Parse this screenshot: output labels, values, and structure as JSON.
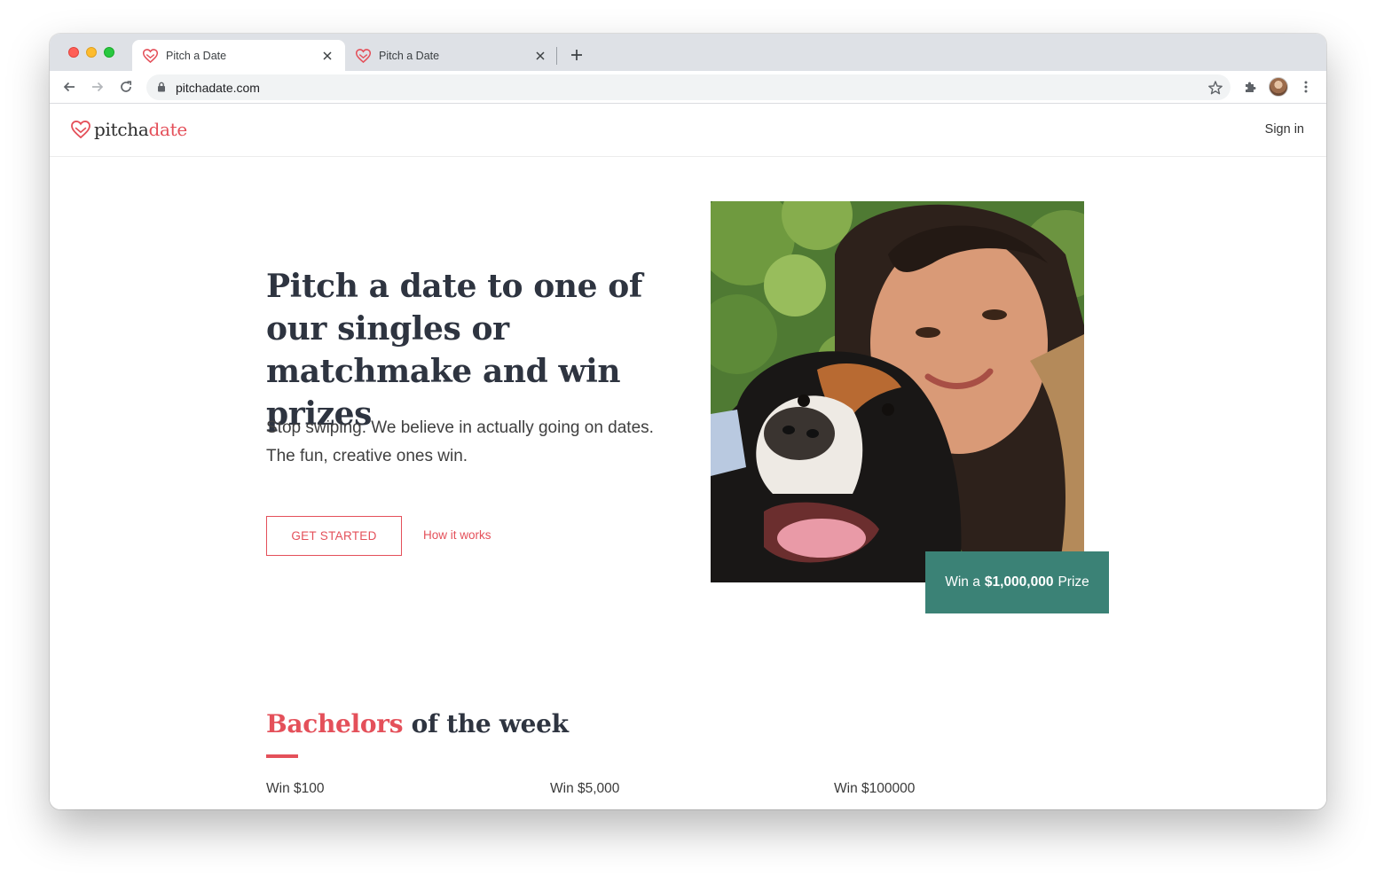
{
  "browser": {
    "tabs": [
      {
        "title": "Pitch a Date",
        "active": true
      },
      {
        "title": "Pitch a Date",
        "active": false
      }
    ],
    "new_tab_icon": "plus-icon",
    "url": "pitchadate.com"
  },
  "site": {
    "logo": {
      "part1": "pitcha",
      "part2": "date"
    },
    "sign_in": "Sign in"
  },
  "hero": {
    "title": "Pitch a date to one of our singles or matchmake and win prizes",
    "subtitle": "Stop swiping. We believe in actually going on dates. The fun, creative ones win.",
    "cta_primary": "GET STARTED",
    "cta_secondary": "How it works",
    "prize_badge": {
      "prefix": "Win a",
      "amount": "$1,000,000",
      "suffix": "Prize"
    }
  },
  "bachelors": {
    "title_accent": "Bachelors",
    "title_rest": "of the week",
    "prizes": [
      "Win $100",
      "Win $5,000",
      "Win $100000"
    ]
  },
  "colors": {
    "brand": "#e4505a",
    "badge": "#3b8276",
    "heading": "#2e3440"
  }
}
